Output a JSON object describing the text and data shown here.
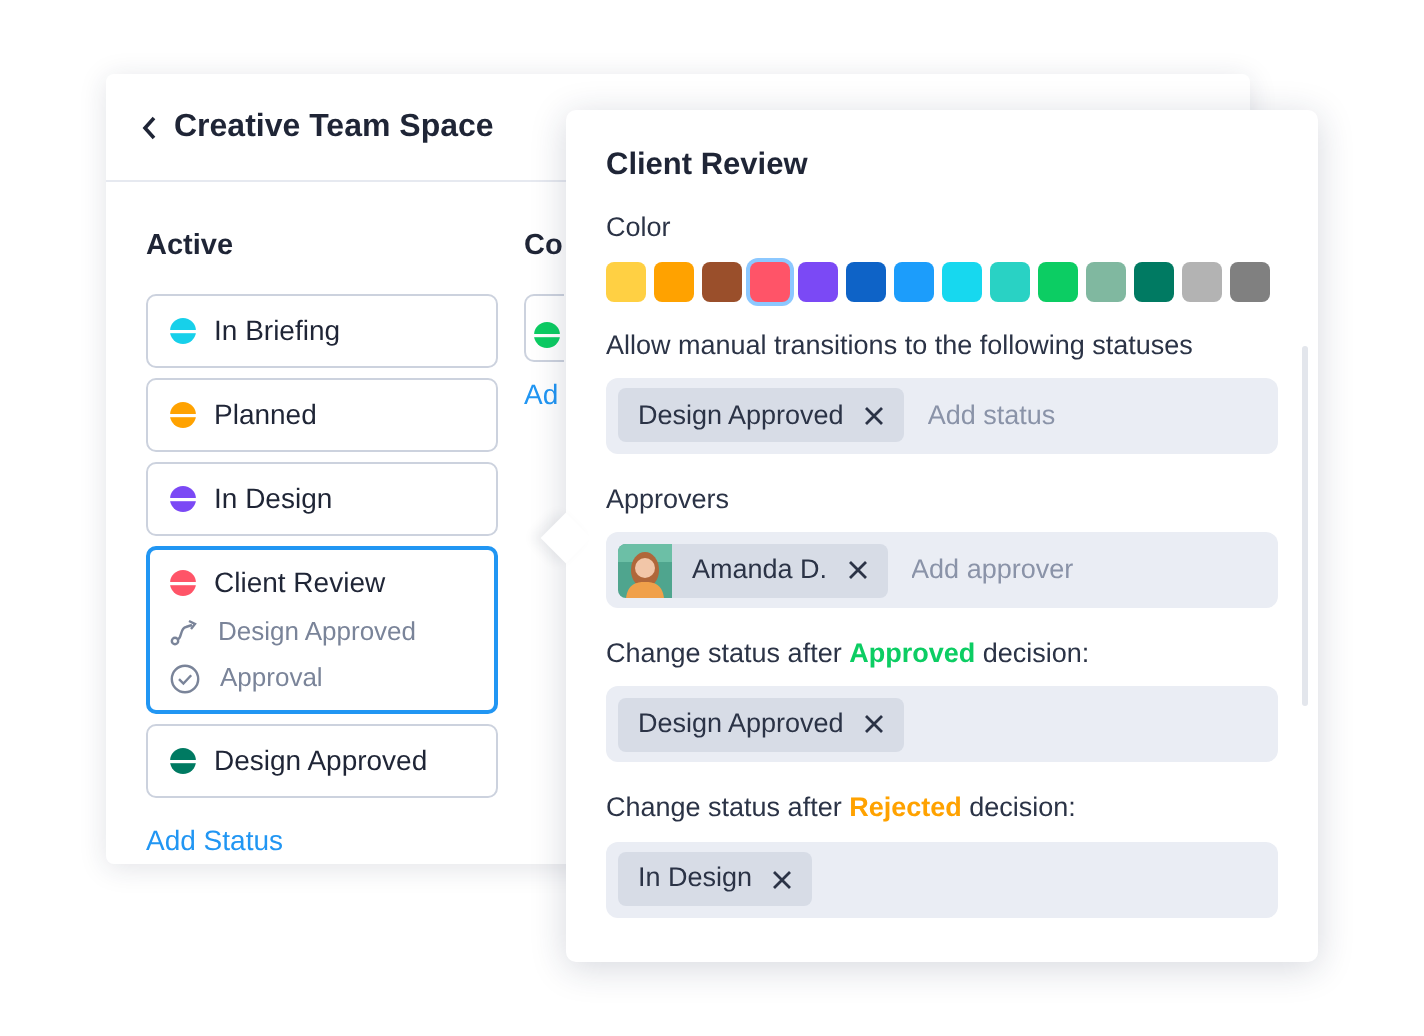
{
  "space": {
    "title": "Creative Team Space"
  },
  "columns": [
    {
      "heading": "Active",
      "statuses": [
        {
          "label": "In Briefing",
          "color": "#17d0ea",
          "selected": false
        },
        {
          "label": "Planned",
          "color": "#ffa200",
          "selected": false
        },
        {
          "label": "In Design",
          "color": "#7b49f5",
          "selected": false
        },
        {
          "label": "Client Review",
          "color": "#ff5468",
          "selected": true,
          "details": [
            {
              "kind": "transition",
              "text": "Design Approved"
            },
            {
              "kind": "approval",
              "text": "Approval"
            }
          ]
        },
        {
          "label": "Design Approved",
          "color": "#007a62",
          "selected": false
        }
      ],
      "add_link": "Add Status"
    },
    {
      "heading": "Co",
      "statuses": [
        {
          "color": "#0ccd63",
          "selected": false
        }
      ],
      "add_link": "Ad"
    }
  ],
  "panel": {
    "title": "Client Review",
    "color_label": "Color",
    "swatches": [
      {
        "color": "#ffd043",
        "selected": false
      },
      {
        "color": "#ffa200",
        "selected": false
      },
      {
        "color": "#9a4f2b",
        "selected": false
      },
      {
        "color": "#ff5468",
        "selected": true
      },
      {
        "color": "#7b49f5",
        "selected": false
      },
      {
        "color": "#0e63c7",
        "selected": false
      },
      {
        "color": "#1c9dfb",
        "selected": false
      },
      {
        "color": "#17d8ef",
        "selected": false
      },
      {
        "color": "#29d2c4",
        "selected": false
      },
      {
        "color": "#0ccd63",
        "selected": false
      },
      {
        "color": "#80b8a0",
        "selected": false
      },
      {
        "color": "#007a62",
        "selected": false
      },
      {
        "color": "#b3b3b3",
        "selected": false
      },
      {
        "color": "#808080",
        "selected": false
      }
    ],
    "fields": [
      {
        "label": "Allow manual transitions to the following statuses",
        "tags": [
          {
            "kind": "status",
            "label": "Design Approved"
          }
        ],
        "placeholder": "Add status"
      },
      {
        "label": "Approvers",
        "tags": [
          {
            "kind": "person",
            "label": "Amanda D."
          }
        ],
        "placeholder": "Add approver"
      },
      {
        "label": "Change status after **Approved** decision:",
        "color": "#0ccd63",
        "tags": [
          {
            "kind": "status",
            "label": "Design Approved"
          }
        ]
      },
      {
        "label": "Change status after **Rejected** decision:",
        "color": "#ffa200",
        "tags": [
          {
            "kind": "status",
            "label": "In Design"
          }
        ]
      }
    ]
  }
}
